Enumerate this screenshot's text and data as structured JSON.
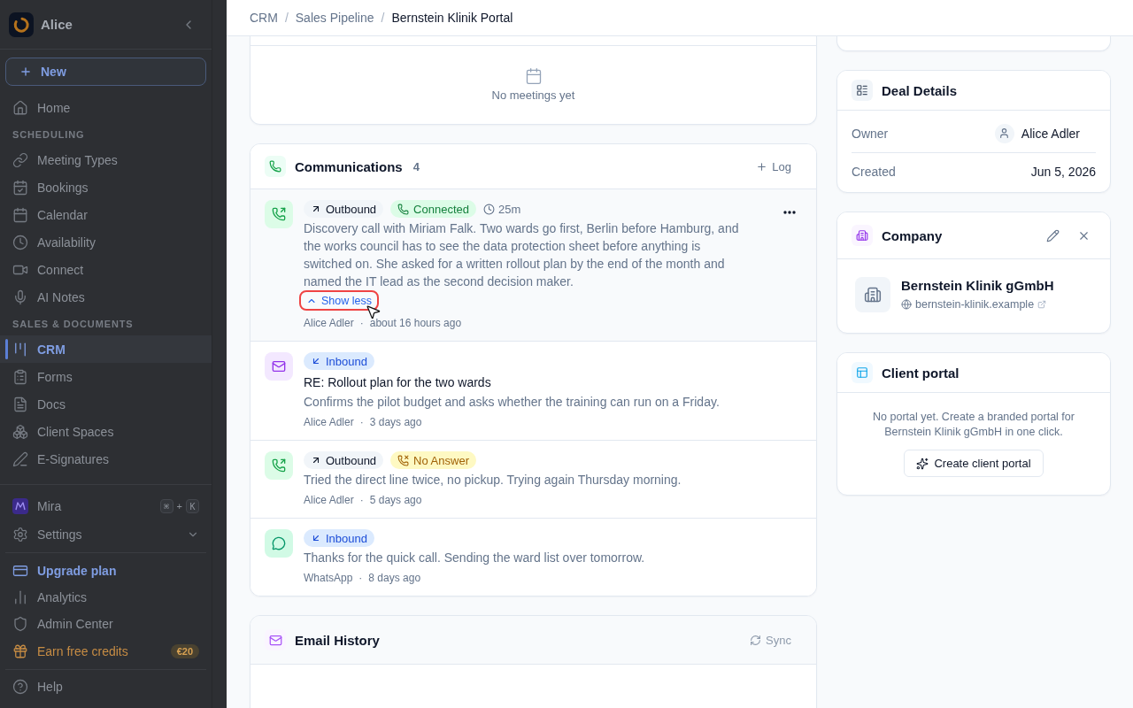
{
  "sidebar": {
    "workspace": {
      "name": "Alice"
    },
    "new_button": {
      "label": "New"
    },
    "nav": [
      {
        "kind": "item",
        "label": "Home",
        "selected": false
      },
      {
        "kind": "section",
        "label": "SCHEDULING"
      },
      {
        "kind": "item",
        "label": "Meeting Types",
        "selected": false
      },
      {
        "kind": "item",
        "label": "Bookings",
        "selected": false
      },
      {
        "kind": "item",
        "label": "Calendar",
        "selected": false
      },
      {
        "kind": "item",
        "label": "Availability",
        "selected": false
      },
      {
        "kind": "item",
        "label": "Connect",
        "selected": false
      },
      {
        "kind": "item",
        "label": "AI Notes",
        "selected": false
      },
      {
        "kind": "section",
        "label": "SALES & DOCUMENTS"
      },
      {
        "kind": "item",
        "label": "CRM",
        "selected": true
      },
      {
        "kind": "item",
        "label": "Forms",
        "selected": false
      },
      {
        "kind": "item",
        "label": "Docs",
        "selected": false
      },
      {
        "kind": "item",
        "label": "Client Spaces",
        "selected": false
      },
      {
        "kind": "item",
        "label": "E-Signatures",
        "selected": false
      }
    ],
    "assistant": {
      "label": "Mira",
      "shortcut": {
        "keys": [
          "⌘",
          "K"
        ],
        "joiner": "+"
      }
    },
    "settings": {
      "label": "Settings",
      "expanded": false
    },
    "footer": [
      {
        "kind": "upgrade",
        "label": "Upgrade plan"
      },
      {
        "kind": "item",
        "label": "Analytics"
      },
      {
        "kind": "item",
        "label": "Admin Center"
      },
      {
        "kind": "reward",
        "label": "Earn free credits",
        "badge": "€20"
      }
    ],
    "help": {
      "label": "Help"
    }
  },
  "breadcrumb": {
    "separator": "/",
    "items": [
      {
        "label": "CRM",
        "current": false
      },
      {
        "label": "Sales Pipeline",
        "current": false
      },
      {
        "label": "Bernstein Klinik Portal",
        "current": true
      }
    ]
  },
  "meetings": {
    "empty_text": "No meetings yet"
  },
  "communications": {
    "title": "Communications",
    "count": "4",
    "log_button": "Log",
    "meta_separator": "·",
    "items": [
      {
        "kind": "call",
        "highlighted": true,
        "direction": {
          "kind": "outbound",
          "label": "Outbound"
        },
        "status": {
          "kind": "connected",
          "label": "Connected"
        },
        "duration": "25m",
        "body": "Discovery call with Miriam Falk. Two wards go first, Berlin before Hamburg, and the works council has to see the data protection sheet before anything is switched on. She asked for a written rollout plan by the end of the month and named the IT lead as the second decision maker.",
        "toggle": {
          "label": "Show less",
          "expanded": true
        },
        "author": "Alice Adler",
        "time": "about 16 hours ago"
      },
      {
        "kind": "email",
        "highlighted": false,
        "direction": {
          "kind": "inbound",
          "label": "Inbound"
        },
        "subject": "RE: Rollout plan for the two wards",
        "body": "Confirms the pilot budget and asks whether the training can run on a Friday.",
        "author": "Alice Adler",
        "time": "3 days ago"
      },
      {
        "kind": "call",
        "highlighted": false,
        "direction": {
          "kind": "outbound",
          "label": "Outbound"
        },
        "status": {
          "kind": "no_answer",
          "label": "No Answer"
        },
        "body": "Tried the direct line twice, no pickup. Trying again Thursday morning.",
        "author": "Alice Adler",
        "time": "5 days ago"
      },
      {
        "kind": "whatsapp",
        "highlighted": false,
        "direction": {
          "kind": "inbound",
          "label": "Inbound"
        },
        "body": "Thanks for the quick call. Sending the ward list over tomorrow.",
        "author": "WhatsApp",
        "time": "8 days ago"
      }
    ]
  },
  "email_history": {
    "title": "Email History",
    "sync_button": {
      "label": "Sync",
      "disabled": true
    }
  },
  "deal_details": {
    "title": "Deal Details",
    "fields": [
      {
        "kind": "person",
        "label": "Owner",
        "value": "Alice Adler"
      },
      {
        "kind": "text",
        "label": "Created",
        "value": "Jun 5, 2026"
      }
    ]
  },
  "company": {
    "title": "Company",
    "name": "Bernstein Klinik gGmbH",
    "website": "bernstein-klinik.example"
  },
  "client_portal": {
    "title": "Client portal",
    "message": "No portal yet. Create a branded portal for Bernstein Klinik gGmbH in one click.",
    "button": "Create client portal"
  }
}
